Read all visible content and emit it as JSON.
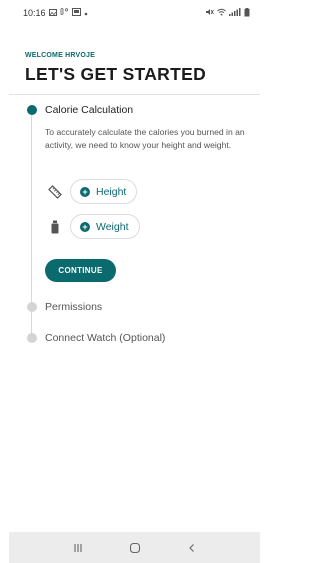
{
  "status_bar": {
    "time": "10:16",
    "left_icons": [
      "image-icon",
      "temperature-icon",
      "screenshot-icon",
      "dot-icon"
    ],
    "right_icons": [
      "mute-icon",
      "wifi-icon",
      "signal-icon",
      "battery-icon"
    ]
  },
  "header": {
    "welcome": "WELCOME HRVOJE",
    "title": "LET'S GET STARTED"
  },
  "steps": [
    {
      "label": "Calorie Calculation",
      "active": true,
      "description": "To accurately calculate the calories you burned in an activity, we need to know your height and weight.",
      "fields": [
        {
          "icon": "ruler-icon",
          "label": "Height"
        },
        {
          "icon": "weight-icon",
          "label": "Weight"
        }
      ],
      "button": "CONTINUE"
    },
    {
      "label": "Permissions",
      "active": false
    },
    {
      "label": "Connect Watch (Optional)",
      "active": false
    }
  ],
  "nav_bar": {
    "buttons": [
      "recent-apps-icon",
      "home-icon",
      "back-icon"
    ]
  },
  "colors": {
    "accent": "#0b6a6e",
    "inactive_dot": "#d4d4d4",
    "nav_background": "#ececec"
  }
}
